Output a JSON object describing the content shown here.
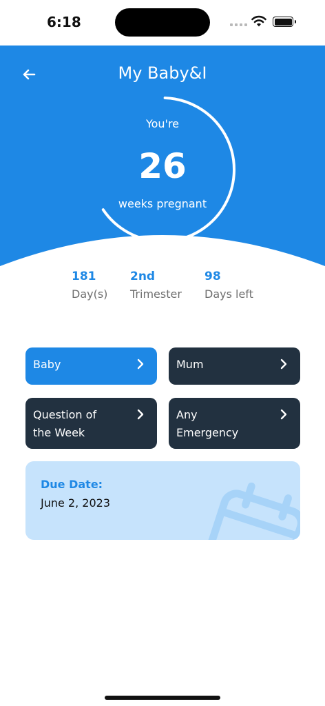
{
  "status_bar": {
    "time": "6:18"
  },
  "header": {
    "title": "My Baby&I",
    "back_icon": "arrow-left-icon"
  },
  "pregnancy": {
    "prefix": "You're",
    "weeks": "26",
    "suffix": "weeks pregnant",
    "progress_fraction": 0.65
  },
  "stats": [
    {
      "value": "181",
      "label": "Day(s)"
    },
    {
      "value": "2nd",
      "label": "Trimester"
    },
    {
      "value": "98",
      "label": "Days left"
    }
  ],
  "tiles": [
    {
      "line1": "Baby",
      "line2": ""
    },
    {
      "line1": "Mum",
      "line2": ""
    },
    {
      "line1": "Question of",
      "line2": "the Week"
    },
    {
      "line1": "Any",
      "line2": "Emergency"
    }
  ],
  "due_date": {
    "label": "Due Date:",
    "value": "June 2, 2023",
    "icon": "calendar-icon"
  },
  "colors": {
    "primary": "#1e88e5",
    "dark_tile": "#223140",
    "due_card": "#c6e3fc"
  }
}
